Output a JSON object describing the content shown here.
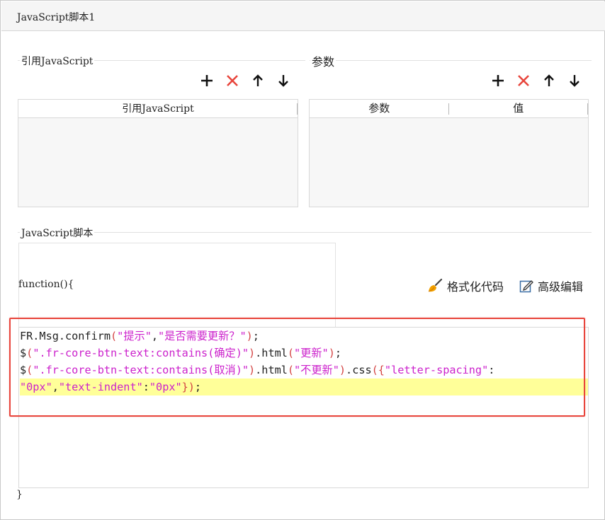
{
  "window": {
    "title": "JavaScript脚本1"
  },
  "import_section": {
    "label": "引用JavaScript",
    "column_header": "引用JavaScript"
  },
  "params_section": {
    "label": "参数",
    "columns": [
      "参数",
      "值"
    ]
  },
  "toolbar_icons": [
    "add-icon",
    "delete-icon",
    "move-up-icon",
    "move-down-icon"
  ],
  "script_section": {
    "label": "JavaScript脚本",
    "function_open": "function(){",
    "function_close": "}",
    "format_label": "格式化代码",
    "advanced_label": "高级编辑"
  },
  "code": {
    "lines": [
      [
        {
          "t": "FR.Msg.confirm",
          "c": "plain"
        },
        {
          "t": "(",
          "c": "paren"
        },
        {
          "t": "\"提示\"",
          "c": "str"
        },
        {
          "t": ",",
          "c": "plain"
        },
        {
          "t": "\"是否需要更新？\"",
          "c": "str"
        },
        {
          "t": ")",
          "c": "paren"
        },
        {
          "t": ";",
          "c": "plain"
        }
      ],
      [
        {
          "t": "$",
          "c": "plain"
        },
        {
          "t": "(",
          "c": "paren"
        },
        {
          "t": "\".fr-core-btn-text:contains(确定)\"",
          "c": "str"
        },
        {
          "t": ")",
          "c": "paren"
        },
        {
          "t": ".html",
          "c": "plain"
        },
        {
          "t": "(",
          "c": "paren"
        },
        {
          "t": "\"更新\"",
          "c": "str"
        },
        {
          "t": ")",
          "c": "paren"
        },
        {
          "t": ";",
          "c": "plain"
        }
      ],
      [
        {
          "t": "$",
          "c": "plain"
        },
        {
          "t": "(",
          "c": "paren"
        },
        {
          "t": "\".fr-core-btn-text:contains(取消)\"",
          "c": "str"
        },
        {
          "t": ")",
          "c": "paren"
        },
        {
          "t": ".html",
          "c": "plain"
        },
        {
          "t": "(",
          "c": "paren"
        },
        {
          "t": "\"不更新\"",
          "c": "str"
        },
        {
          "t": ")",
          "c": "paren"
        },
        {
          "t": ".css",
          "c": "plain"
        },
        {
          "t": "({",
          "c": "paren"
        },
        {
          "t": "\"letter-spacing\"",
          "c": "str"
        },
        {
          "t": ":",
          "c": "plain"
        }
      ],
      [
        {
          "t": "\"0px\"",
          "c": "str"
        },
        {
          "t": ",",
          "c": "plain"
        },
        {
          "t": "\"text-indent\"",
          "c": "str"
        },
        {
          "t": ":",
          "c": "plain"
        },
        {
          "t": "\"0px\"",
          "c": "str"
        },
        {
          "t": "})",
          "c": "paren"
        },
        {
          "t": ";",
          "c": "plain"
        }
      ]
    ],
    "highlighted_line": 4
  },
  "colors": {
    "string": "#cc22cc",
    "paren": "#d44444",
    "highlight": "#ffff99",
    "callout_border": "#e8453c",
    "delete_icon": "#e8453c"
  }
}
